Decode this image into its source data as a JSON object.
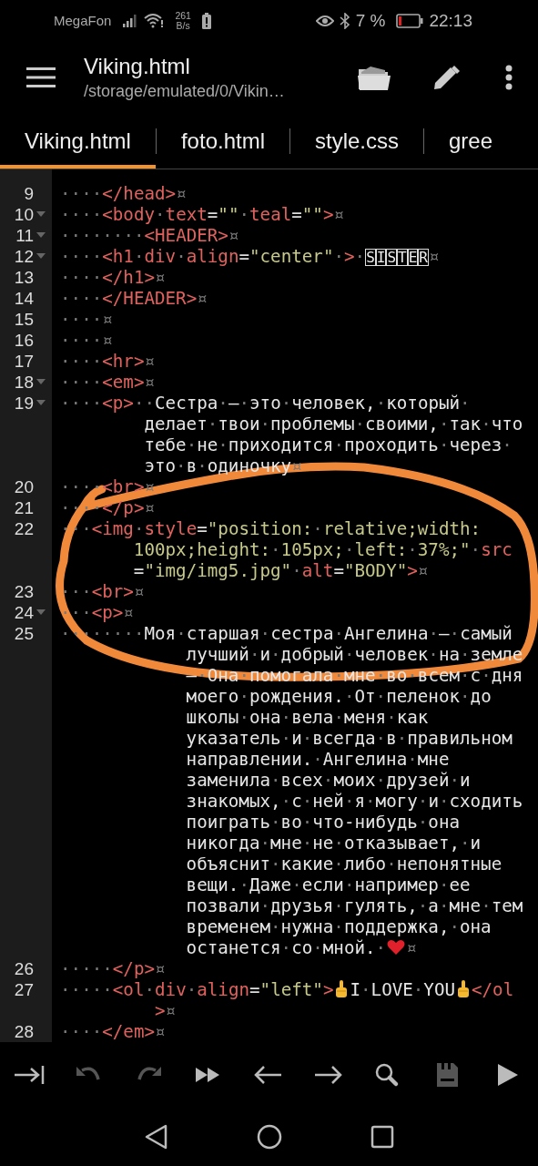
{
  "status_bar": {
    "carrier": "MegaFon",
    "speed_value": "261",
    "speed_unit": "B/s",
    "battery_percent": "7 %",
    "time": "22:13"
  },
  "app_bar": {
    "title": "Viking.html",
    "path": "/storage/emulated/0/Vikin…"
  },
  "tabs": [
    {
      "label": "Viking.html",
      "selected": true
    },
    {
      "label": "foto.html",
      "selected": false
    },
    {
      "label": "style.css",
      "selected": false
    },
    {
      "label": "gree",
      "selected": false
    }
  ],
  "editor": {
    "lines": [
      {
        "number": "9",
        "fold": false,
        "wraps": [
          {
            "tokens": [
              {
                "kind": "text",
                "text": "····"
              },
              {
                "kind": "tag",
                "text": "</head>"
              },
              {
                "kind": "text",
                "text": "¤"
              }
            ]
          }
        ]
      },
      {
        "number": "10",
        "fold": true,
        "wraps": [
          {
            "tokens": [
              {
                "kind": "text",
                "text": "····"
              },
              {
                "kind": "tag",
                "text": "<body"
              },
              {
                "kind": "text",
                "text": "·"
              },
              {
                "kind": "attr",
                "text": "text"
              },
              {
                "kind": "op",
                "text": "="
              },
              {
                "kind": "str",
                "text": "\"\""
              },
              {
                "kind": "text",
                "text": "·"
              },
              {
                "kind": "attr",
                "text": "teal"
              },
              {
                "kind": "op",
                "text": "="
              },
              {
                "kind": "str",
                "text": "\"\""
              },
              {
                "kind": "tag",
                "text": ">"
              },
              {
                "kind": "text",
                "text": "¤"
              }
            ]
          }
        ]
      },
      {
        "number": "11",
        "fold": true,
        "wraps": [
          {
            "tokens": [
              {
                "kind": "text",
                "text": "········"
              },
              {
                "kind": "tag",
                "text": "<HEADER>"
              },
              {
                "kind": "text",
                "text": "¤"
              }
            ]
          }
        ]
      },
      {
        "number": "12",
        "fold": true,
        "wraps": [
          {
            "tokens": [
              {
                "kind": "text",
                "text": "····"
              },
              {
                "kind": "tag",
                "text": "<h1"
              },
              {
                "kind": "text",
                "text": "·"
              },
              {
                "kind": "attr",
                "text": "div"
              },
              {
                "kind": "text",
                "text": "·"
              },
              {
                "kind": "attr",
                "text": "align"
              },
              {
                "kind": "op",
                "text": "="
              },
              {
                "kind": "str",
                "text": "\"center\""
              },
              {
                "kind": "text",
                "text": "·"
              },
              {
                "kind": "tag",
                "text": ">"
              },
              {
                "kind": "text",
                "text": "·"
              },
              {
                "kind": "boxed",
                "text": "SISTER"
              },
              {
                "kind": "text",
                "text": "¤"
              }
            ]
          }
        ]
      },
      {
        "number": "13",
        "fold": false,
        "wraps": [
          {
            "tokens": [
              {
                "kind": "text",
                "text": "····"
              },
              {
                "kind": "tag",
                "text": "</h1>"
              },
              {
                "kind": "text",
                "text": "¤"
              }
            ]
          }
        ]
      },
      {
        "number": "14",
        "fold": false,
        "wraps": [
          {
            "tokens": [
              {
                "kind": "text",
                "text": "····"
              },
              {
                "kind": "tag",
                "text": "</HEADER>"
              },
              {
                "kind": "text",
                "text": "¤"
              }
            ]
          }
        ]
      },
      {
        "number": "15",
        "fold": false,
        "wraps": [
          {
            "tokens": [
              {
                "kind": "text",
                "text": "····¤"
              }
            ]
          }
        ]
      },
      {
        "number": "16",
        "fold": false,
        "wraps": [
          {
            "tokens": [
              {
                "kind": "text",
                "text": "····¤"
              }
            ]
          }
        ]
      },
      {
        "number": "17",
        "fold": false,
        "wraps": [
          {
            "tokens": [
              {
                "kind": "text",
                "text": "····"
              },
              {
                "kind": "tag",
                "text": "<hr>"
              },
              {
                "kind": "text",
                "text": "¤"
              }
            ]
          }
        ]
      },
      {
        "number": "18",
        "fold": true,
        "wraps": [
          {
            "tokens": [
              {
                "kind": "text",
                "text": "····"
              },
              {
                "kind": "tag",
                "text": "<em>"
              },
              {
                "kind": "text",
                "text": "¤"
              }
            ]
          }
        ]
      },
      {
        "number": "19",
        "fold": true,
        "wraps": [
          {
            "tokens": [
              {
                "kind": "text",
                "text": "····"
              },
              {
                "kind": "tag",
                "text": "<p>"
              },
              {
                "kind": "text",
                "text": "··Сестра·–·это·человек,·который·"
              }
            ]
          },
          {
            "tokens": [
              {
                "kind": "text",
                "text": "делает·твои·проблемы·своими,·так·что"
              }
            ]
          },
          {
            "tokens": [
              {
                "kind": "text",
                "text": "тебе·не·приходится·проходить·через·"
              }
            ]
          },
          {
            "tokens": [
              {
                "kind": "text",
                "text": "это·в·одиночку¤"
              }
            ]
          }
        ]
      },
      {
        "number": "20",
        "fold": false,
        "wraps": [
          {
            "tokens": [
              {
                "kind": "text",
                "text": "····"
              },
              {
                "kind": "tag",
                "text": "<br>"
              },
              {
                "kind": "text",
                "text": "¤"
              }
            ]
          }
        ]
      },
      {
        "number": "21",
        "fold": false,
        "wraps": [
          {
            "tokens": [
              {
                "kind": "text",
                "text": "····"
              },
              {
                "kind": "tag",
                "text": "</p>"
              },
              {
                "kind": "text",
                "text": "¤"
              }
            ]
          }
        ]
      },
      {
        "number": "22",
        "fold": false,
        "wraps": [
          {
            "tokens": [
              {
                "kind": "text",
                "text": "···"
              },
              {
                "kind": "tag",
                "text": "<img"
              },
              {
                "kind": "text",
                "text": "·"
              },
              {
                "kind": "attr",
                "text": "style"
              },
              {
                "kind": "op",
                "text": "="
              },
              {
                "kind": "str",
                "text": "\"position:·relative;width:"
              }
            ]
          },
          {
            "tokens": [
              {
                "kind": "str",
                "text": "100px;height:·105px;·left:·37%;\""
              },
              {
                "kind": "text",
                "text": "·"
              },
              {
                "kind": "attr",
                "text": "src"
              }
            ]
          },
          {
            "tokens": [
              {
                "kind": "op",
                "text": "="
              },
              {
                "kind": "str",
                "text": "\"img/img5.jpg\""
              },
              {
                "kind": "text",
                "text": "·"
              },
              {
                "kind": "attr",
                "text": "alt"
              },
              {
                "kind": "op",
                "text": "="
              },
              {
                "kind": "str",
                "text": "\"BODY\""
              },
              {
                "kind": "tag",
                "text": ">"
              },
              {
                "kind": "text",
                "text": "¤"
              }
            ]
          }
        ]
      },
      {
        "number": "23",
        "fold": false,
        "wraps": [
          {
            "tokens": [
              {
                "kind": "text",
                "text": "···"
              },
              {
                "kind": "tag",
                "text": "<br>"
              },
              {
                "kind": "text",
                "text": "¤"
              }
            ]
          }
        ]
      },
      {
        "number": "24",
        "fold": true,
        "wraps": [
          {
            "tokens": [
              {
                "kind": "text",
                "text": "···"
              },
              {
                "kind": "tag",
                "text": "<p>"
              },
              {
                "kind": "text",
                "text": "¤"
              }
            ]
          }
        ]
      },
      {
        "number": "25",
        "fold": false,
        "wraps": [
          {
            "tokens": [
              {
                "kind": "text",
                "text": "········Моя·старшая·сестра·Ангелина·–·самый"
              }
            ]
          },
          {
            "tokens": [
              {
                "kind": "text",
                "text": "лучший·и·добрый·человек·на·земле"
              }
            ]
          },
          {
            "tokens": [
              {
                "kind": "text",
                "text": "–·Она·помогала·мне·во·всем·с·дня"
              }
            ]
          },
          {
            "tokens": [
              {
                "kind": "text",
                "text": "моего·рождения.·От·пеленок·до"
              }
            ]
          },
          {
            "tokens": [
              {
                "kind": "text",
                "text": "школы·она·вела·меня·как"
              }
            ]
          },
          {
            "tokens": [
              {
                "kind": "text",
                "text": "указатель·и·всегда·в·правильном"
              }
            ]
          },
          {
            "tokens": [
              {
                "kind": "text",
                "text": "направлении.·Ангелина·мне"
              }
            ]
          },
          {
            "tokens": [
              {
                "kind": "text",
                "text": "заменила·всех·моих·друзей·и"
              }
            ]
          },
          {
            "tokens": [
              {
                "kind": "text",
                "text": "знакомых,·с·ней·я·могу·и·сходить"
              }
            ]
          },
          {
            "tokens": [
              {
                "kind": "text",
                "text": "поиграть·во·что-нибудь·она"
              }
            ]
          },
          {
            "tokens": [
              {
                "kind": "text",
                "text": "никогда·мне·не·отказывает,·и"
              }
            ]
          },
          {
            "tokens": [
              {
                "kind": "text",
                "text": "объяснит·какие·либо·непонятные"
              }
            ]
          },
          {
            "tokens": [
              {
                "kind": "text",
                "text": "вещи.·Даже·если·например·ее"
              }
            ]
          },
          {
            "tokens": [
              {
                "kind": "text",
                "text": "позвали·друзья·гулять,·а·мне·тем"
              }
            ]
          },
          {
            "tokens": [
              {
                "kind": "text",
                "text": "временем·нужна·поддержка,·она"
              }
            ]
          },
          {
            "tokens": [
              {
                "kind": "text",
                "text": "останется·со·мной.·"
              },
              {
                "kind": "heart"
              },
              {
                "kind": "text",
                "text": "¤"
              }
            ]
          }
        ]
      },
      {
        "number": "26",
        "fold": false,
        "wraps": [
          {
            "tokens": [
              {
                "kind": "text",
                "text": "·····"
              },
              {
                "kind": "tag",
                "text": "</p>"
              },
              {
                "kind": "text",
                "text": "¤"
              }
            ]
          }
        ]
      },
      {
        "number": "27",
        "fold": false,
        "wraps": [
          {
            "tokens": [
              {
                "kind": "text",
                "text": "·····"
              },
              {
                "kind": "tag",
                "text": "<ol"
              },
              {
                "kind": "text",
                "text": "·"
              },
              {
                "kind": "attr",
                "text": "div"
              },
              {
                "kind": "text",
                "text": "·"
              },
              {
                "kind": "attr",
                "text": "align"
              },
              {
                "kind": "op",
                "text": "="
              },
              {
                "kind": "str",
                "text": "\"left\""
              },
              {
                "kind": "tag",
                "text": ">"
              },
              {
                "kind": "hand"
              },
              {
                "kind": "text",
                "text": "I·LOVE·YOU"
              },
              {
                "kind": "hand"
              },
              {
                "kind": "tag",
                "text": "</ol"
              }
            ]
          },
          {
            "tokens": [
              {
                "kind": "tag",
                "text": ">"
              },
              {
                "kind": "text",
                "text": "¤"
              }
            ]
          }
        ]
      },
      {
        "number": "28",
        "fold": false,
        "wraps": [
          {
            "tokens": [
              {
                "kind": "text",
                "text": "····"
              },
              {
                "kind": "tag",
                "text": "</em>"
              },
              {
                "kind": "text",
                "text": "¤"
              }
            ]
          }
        ]
      }
    ]
  },
  "toolbar": [
    {
      "kind": "indent",
      "disabled": false
    },
    {
      "kind": "undo",
      "disabled": true
    },
    {
      "kind": "redo",
      "disabled": true
    },
    {
      "kind": "fast-forward",
      "disabled": false
    },
    {
      "kind": "back",
      "disabled": false
    },
    {
      "kind": "forward",
      "disabled": false
    },
    {
      "kind": "search",
      "disabled": false
    },
    {
      "kind": "save",
      "disabled": true
    },
    {
      "kind": "run",
      "disabled": false
    }
  ]
}
